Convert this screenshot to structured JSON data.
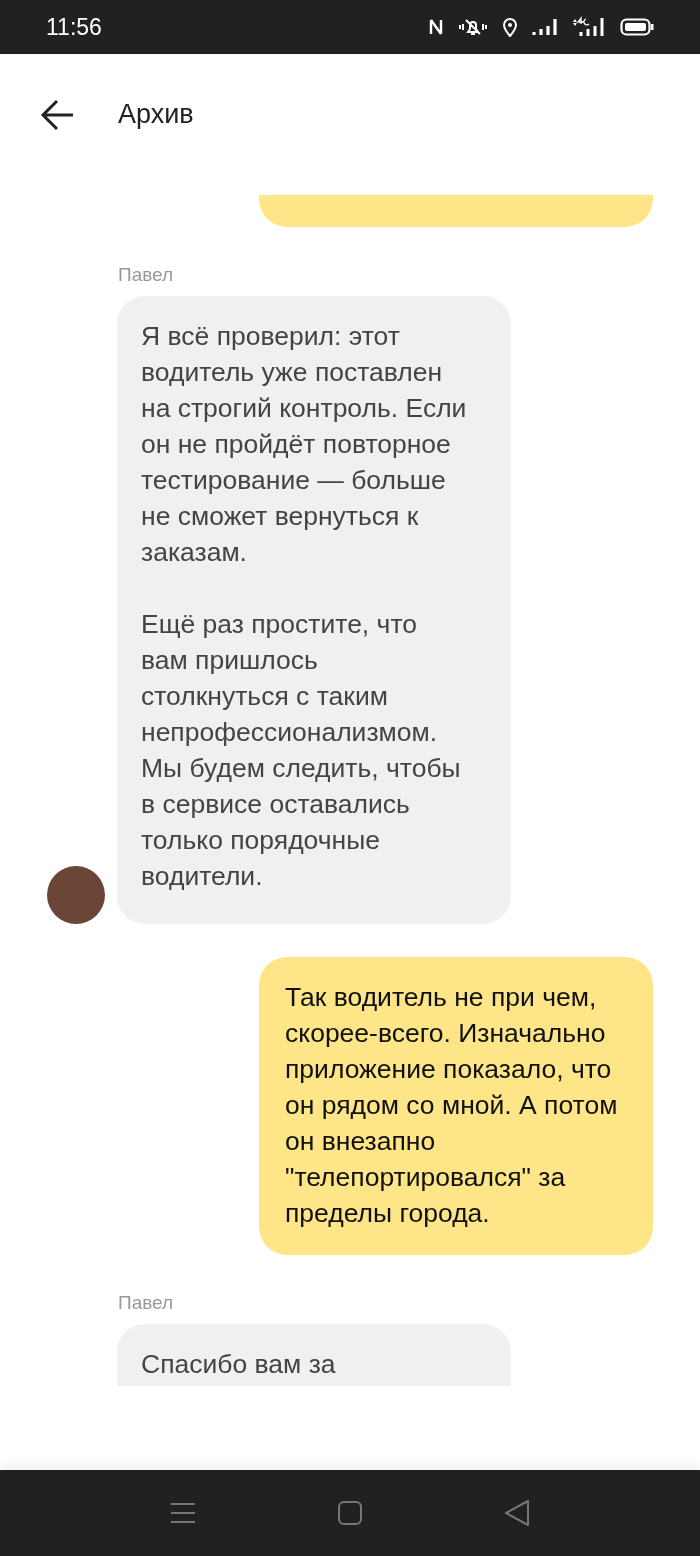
{
  "status_bar": {
    "time": "11:56"
  },
  "header": {
    "title": "Архив"
  },
  "messages": [
    {
      "kind": "outgoing",
      "cut_top": true,
      "cut_bottom": false
    },
    {
      "kind": "incoming",
      "sender": "Павел",
      "avatar": true,
      "cut_top": false,
      "cut_bottom": false,
      "paragraphs": [
        "Я всё проверил: этот водитель уже поставлен на строгий контроль. Если он не пройдёт повторное тестирование — больше не сможет вернуться к заказам.",
        "Ещё раз простите, что вам пришлось столкнуться с таким непрофессионализмом. Мы будем следить, чтобы в сервисе оставались только порядочные водители."
      ]
    },
    {
      "kind": "outgoing",
      "cut_top": false,
      "cut_bottom": false,
      "paragraphs": [
        "Так водитель не при чем, скорее-всего. Изначально приложение показало, что он рядом со мной. А потом он внезапно \"телепортировался\" за пределы города."
      ]
    },
    {
      "kind": "incoming",
      "sender": "Павел",
      "avatar": false,
      "cut_top": false,
      "cut_bottom": true,
      "paragraphs": [
        "Спасибо вам за"
      ]
    }
  ]
}
